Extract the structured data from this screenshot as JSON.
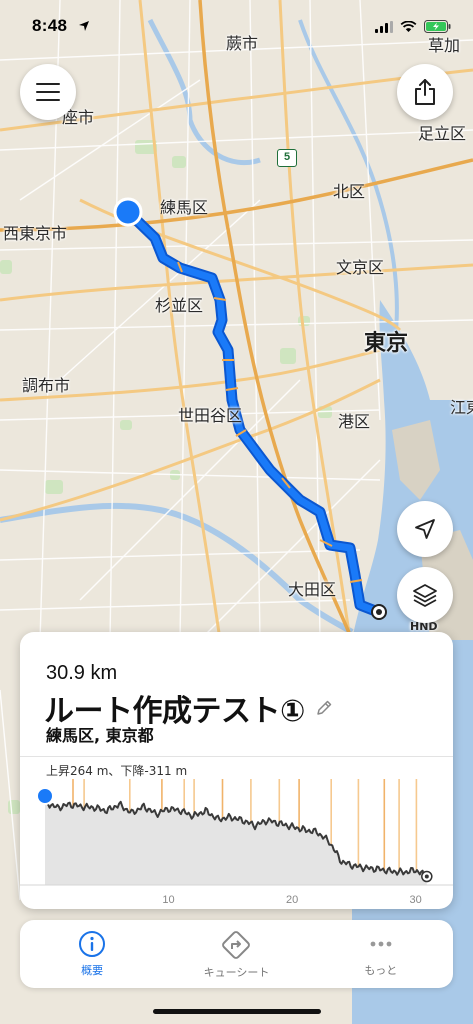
{
  "status_bar": {
    "time": "8:48"
  },
  "map": {
    "labels": {
      "warabi": "蕨市",
      "soka": "草加",
      "adachi": "足立区",
      "shi_left": "座市",
      "nerima": "練馬区",
      "nishitokyo": "西東京市",
      "kita": "北区",
      "bunkyo": "文京区",
      "suginami": "杉並区",
      "tokyo": "東京",
      "chofu": "調布市",
      "setagaya": "世田谷区",
      "minato": "港区",
      "koto": "江東",
      "ota": "大田区",
      "hnd": "HND",
      "route_shield": "5"
    },
    "colors": {
      "route": "#1a7af8",
      "route_dark": "#0b57d0",
      "start_marker": "#1a7af8",
      "land": "#ece7dc",
      "water": "#a9c9e8",
      "park": "#cfe5c0"
    }
  },
  "buttons": {
    "menu": "menu-icon",
    "share": "share-icon",
    "locate": "location-arrow-icon",
    "layers": "layers-icon"
  },
  "route": {
    "distance": "30.9 km",
    "title": "ルート作成テスト①",
    "location": "練馬区, 東京都",
    "elevation_summary": "上昇264 m、下降-311 m"
  },
  "chart_data": {
    "type": "area",
    "title": "",
    "xlabel": "",
    "ylabel": "",
    "x_ticks": [
      10,
      20,
      30
    ],
    "xlim": [
      0,
      31
    ],
    "series": [
      {
        "x": [
          0,
          1,
          2,
          3,
          4,
          5,
          6,
          7,
          8,
          9,
          10,
          11,
          12,
          13,
          14,
          15,
          16,
          17,
          18,
          19,
          20,
          21,
          22,
          23,
          24,
          25,
          26,
          27,
          28,
          29,
          30,
          30.9
        ],
        "values": [
          78,
          73,
          76,
          74,
          73,
          70,
          76,
          68,
          74,
          67,
          72,
          70,
          65,
          70,
          62,
          64,
          61,
          56,
          61,
          58,
          55,
          52,
          50,
          41,
          22,
          18,
          16,
          15,
          13,
          12,
          14,
          8
        ]
      }
    ],
    "grid": false,
    "start_marker": true,
    "end_marker": true
  },
  "tabs": [
    {
      "label": "概要",
      "icon": "info-icon",
      "active": true
    },
    {
      "label": "キューシート",
      "icon": "turn-sign-icon",
      "active": false
    },
    {
      "label": "もっと",
      "icon": "more-dots-icon",
      "active": false
    }
  ]
}
